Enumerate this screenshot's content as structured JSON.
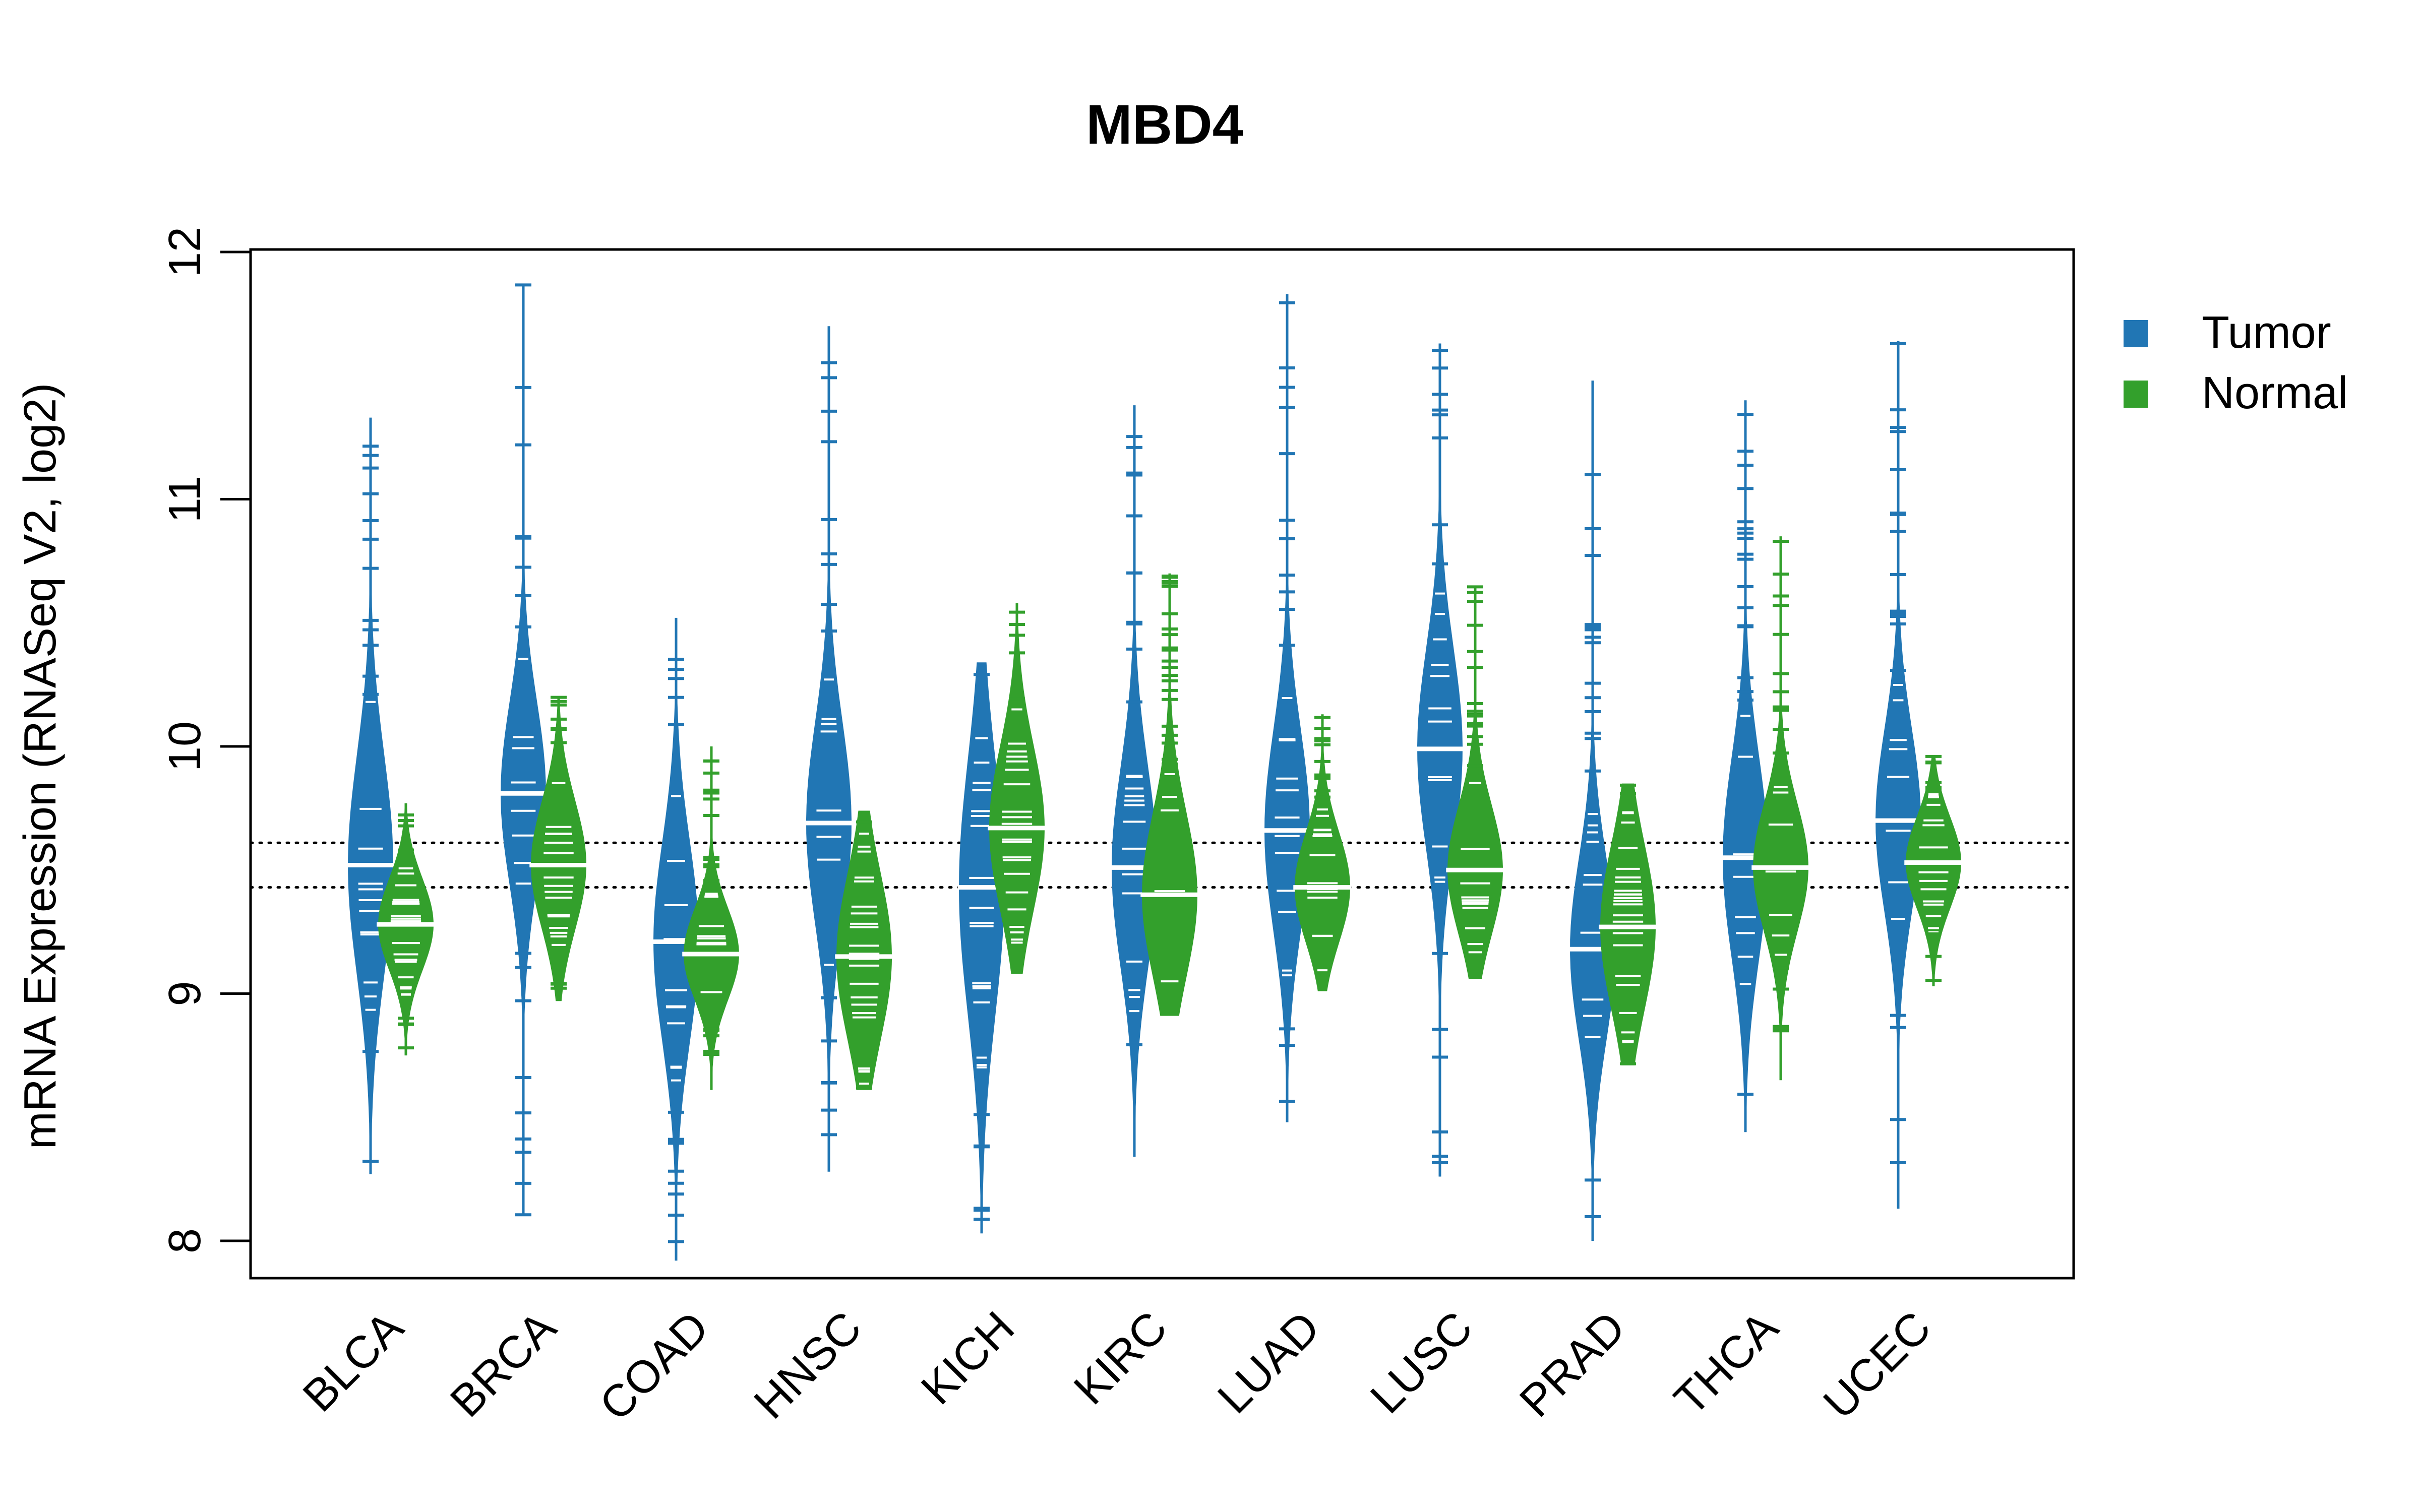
{
  "chart_data": {
    "type": "violin",
    "title": "MBD4",
    "xlabel": "",
    "ylabel": "mRNA Expression (RNASeq V2, log2)",
    "ylim": [
      7.85,
      12.0
    ],
    "yticks": [
      8,
      9,
      10,
      11,
      12
    ],
    "grid": false,
    "legend": {
      "position": "top-right-outside",
      "entries": [
        {
          "label": "Tumor",
          "color": "#2176b4"
        },
        {
          "label": "Normal",
          "color": "#33a02c"
        }
      ]
    },
    "reference_lines": [
      {
        "y": 9.61,
        "style": "dotted"
      },
      {
        "y": 9.43,
        "style": "dotted"
      }
    ],
    "categories": [
      "BLCA",
      "BRCA",
      "COAD",
      "HNSC",
      "KICH",
      "KIRC",
      "LUAD",
      "LUSC",
      "PRAD",
      "THCA",
      "UCEC"
    ],
    "series": [
      {
        "name": "Tumor",
        "color": "#2176b4",
        "median": [
          9.52,
          9.81,
          9.21,
          9.69,
          9.43,
          9.51,
          9.66,
          9.99,
          9.18,
          9.55,
          9.7
        ],
        "min": [
          8.27,
          8.1,
          7.92,
          8.28,
          8.03,
          8.34,
          8.48,
          8.26,
          8.0,
          8.44,
          8.13
        ],
        "max": [
          11.33,
          11.87,
          10.52,
          11.7,
          10.34,
          11.38,
          11.83,
          11.63,
          11.48,
          11.4,
          11.64
        ],
        "q1": [
          9.25,
          9.55,
          8.95,
          9.4,
          9.05,
          9.25,
          9.4,
          9.7,
          8.95,
          9.3,
          9.45
        ],
        "q3": [
          9.85,
          10.05,
          9.5,
          9.95,
          9.75,
          9.8,
          9.95,
          10.25,
          9.45,
          9.85,
          9.95
        ]
      },
      {
        "name": "Normal",
        "color": "#33a02c",
        "median": [
          9.28,
          9.52,
          9.16,
          9.15,
          9.67,
          9.4,
          9.43,
          9.5,
          9.27,
          9.51,
          9.53
        ],
        "min": [
          8.75,
          8.97,
          8.61,
          8.61,
          9.08,
          8.91,
          9.01,
          9.06,
          8.71,
          8.65,
          9.03
        ],
        "max": [
          9.77,
          10.2,
          10.0,
          9.74,
          10.58,
          10.7,
          10.13,
          10.65,
          9.85,
          10.85,
          9.96
        ],
        "q1": [
          9.15,
          9.35,
          9.05,
          8.95,
          9.45,
          9.2,
          9.3,
          9.35,
          9.05,
          9.35,
          9.4
        ],
        "q3": [
          9.4,
          9.7,
          9.3,
          9.4,
          9.9,
          9.65,
          9.6,
          9.7,
          9.5,
          9.7,
          9.65
        ]
      }
    ]
  }
}
